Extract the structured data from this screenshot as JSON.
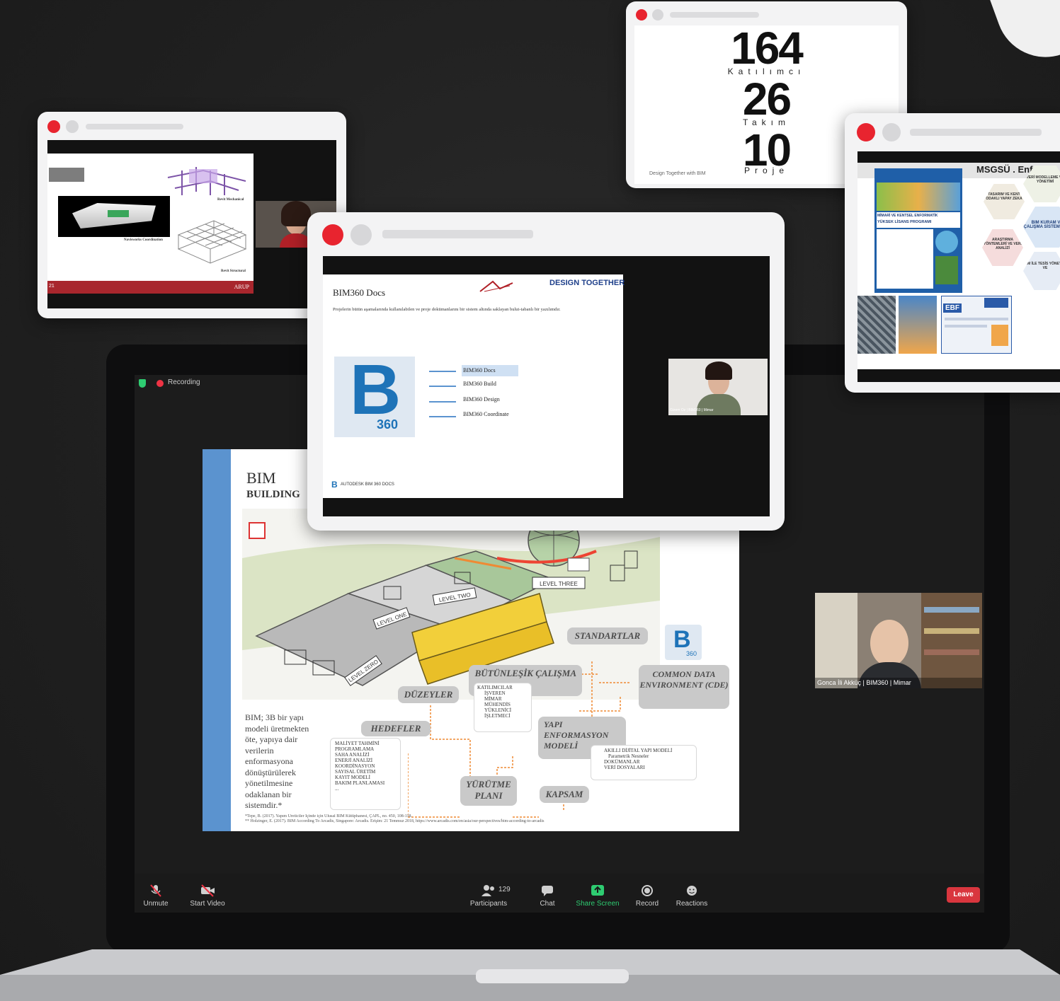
{
  "stats": {
    "participants_value": "164",
    "participants_label": "Katılımcı",
    "teams_value": "26",
    "teams_label": "Takım",
    "projects_value": "10",
    "projects_label": "Proje",
    "footer": "Design Together with BIM"
  },
  "card_left": {
    "labels": [
      "Revit Mechanical",
      "Navisworks Coordination",
      "Revit Structural"
    ],
    "footer_brand": "ARUP",
    "footer_left": "21"
  },
  "card_center": {
    "slide_title": "BIM360 Docs",
    "brand": "DESIGN TOGETHER",
    "paragraph": "Projelerin bütün aşamalarında kullanılabilen ve proje dokümanlarını bir sistem altında saklayan bulut-tabanlı bir yazılımdır.",
    "b_number": "360",
    "list": [
      "BIM360 Docs",
      "BIM360 Build",
      "BIM360 Design",
      "BIM360 Coordinate"
    ],
    "footer": "AUTODESK BIM 360 DOCS",
    "video_caption": "Gizem Oz | BIM360 | Mimar"
  },
  "card_right": {
    "header": "MSGSÜ . Enforma",
    "poster_title": "MİMARİ VE KENTSEL ENFORMATİK",
    "poster_subtitle": "YÜKSEK LİSANS PROGRAMI",
    "hexes": [
      "VERİ MODELLEME VE YÖNETİMİ",
      "TASARIM VE KENT ODAKLI YAPAY ZEKA",
      "BIM KURAM VE ÇALIŞMA SİSTEMATİĞİ",
      "ARAŞTIRMA YÖNTEMLERİ VE VERİ ANALİZİ",
      "BIM İLE TESİS YÖNETİMİ VE"
    ],
    "ebf": "EBF"
  },
  "zoom": {
    "recording": "Recording",
    "participant_count": "129",
    "toolbar": {
      "unmute": "Unmute",
      "start_video": "Start Video",
      "participants": "Participants",
      "chat": "Chat",
      "share_screen": "Share Screen",
      "record": "Record",
      "reactions": "Reactions",
      "leave": "Leave"
    },
    "speaker_caption": "Gonca İli Akküç | BIM360 | Mimar"
  },
  "main_slide": {
    "title": "BIM",
    "subtitle": "BUILDING",
    "body": "BIM; 3B bir yapı modeli üretmekten öte, yapıya dair verilerin enformasyona dönüştürülerek yönetilmesine odaklanan bir sistemdir.*",
    "level_labels": [
      "LEVEL THREE",
      "LEVEL TWO",
      "LEVEL ONE",
      "LEVEL ZERO"
    ],
    "boxes": {
      "standartlar": "STANDARTLAR",
      "butunlesik": "BÜTÜNLEŞİK ÇALIŞMA",
      "cde": "COMMON DATA ENVIRONMENT (CDE)",
      "duzeyler": "DÜZEYLER",
      "hedefler": "HEDEFLER",
      "yapi": "YAPI ENFORMASYON MODELİ",
      "yurutme": "YÜRÜTME PLANI",
      "kapsam": "KAPSAM"
    },
    "katilimcilar_title": "KATILIMCILAR",
    "katilimcilar": [
      "İŞVEREN",
      "MİMAR",
      "MÜHENDİS",
      "YÜKLENİCİ",
      "İŞLETMECİ"
    ],
    "hedefler_list": [
      "MALİYET TAHMİNİ",
      "PROGRAMLAMA",
      "SAHA ANALİZİ",
      "ENERJİ ANALİZİ",
      "KOORDİNASYON",
      "SAYISAL ÜRETİM",
      "KAYIT MODELİ",
      "BAKIM PLANLAMASI",
      "..."
    ],
    "model_list": [
      "AKILLI DİJİTAL YAPI MODELİ",
      "Parametrik Nesneler",
      "DOKÜMANLAR",
      "VERİ DOSYALARI"
    ],
    "b_number": "360",
    "footnote1": "*Tepe, B. (2017). Yapım Üreticiler İçinde için Ulusal BIM Kütüphanesi, ÇAPL, no. 450, 108-118.",
    "footnote2": "** Holzinger, E. (2017). BIM According To Arcadis, Singapore: Arcadis. Erişim: 21 Temmuz 2018, https://www.arcadis.com/en/asia/our-perspectives/bim-according-to-arcadis"
  },
  "colors": {
    "accent_red": "#e8242f",
    "zoom_green": "#2ecc71",
    "leave_red": "#d9363e",
    "slide_blue": "#5b93cf",
    "flow_orange": "#ef8a34"
  }
}
